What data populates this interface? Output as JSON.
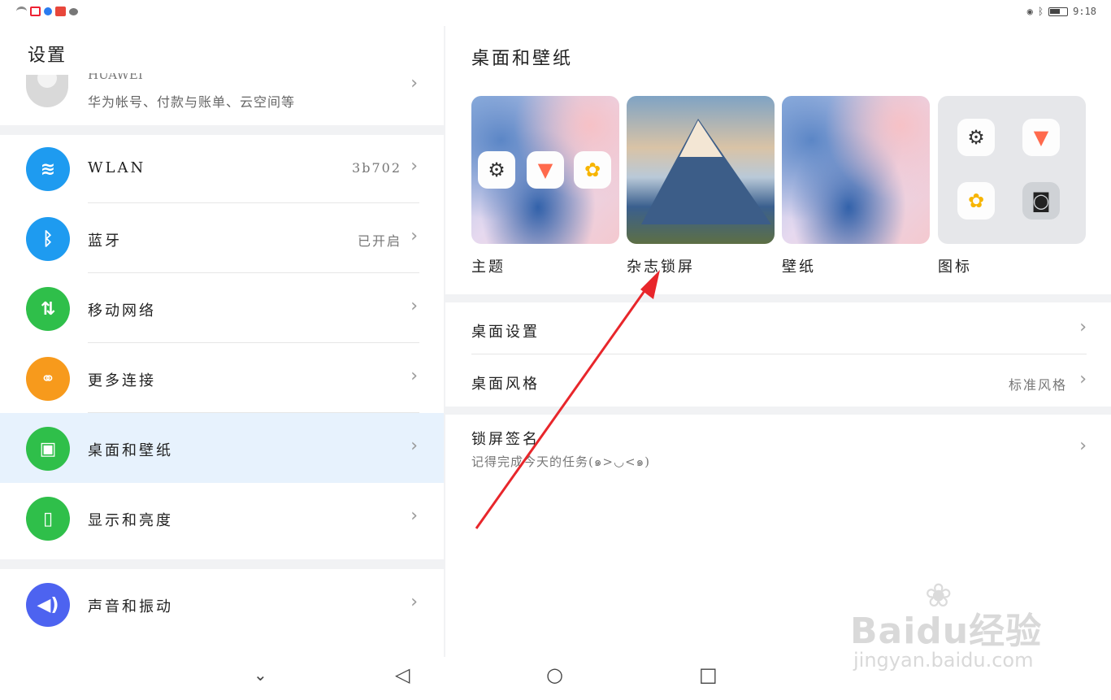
{
  "status_bar": {
    "time": "9:18"
  },
  "left_panel": {
    "title": "设置",
    "account": {
      "name": "HUAWEI",
      "subtitle": "华为帐号、付款与账单、云空间等"
    },
    "items": [
      {
        "label": "WLAN",
        "value": "3b702",
        "color": "#1e9bf0",
        "icon": "wifi-icon",
        "glyph": "≋"
      },
      {
        "label": "蓝牙",
        "value": "已开启",
        "color": "#1e9bf0",
        "icon": "bluetooth-icon",
        "glyph": "ᛒ"
      },
      {
        "label": "移动网络",
        "value": "",
        "color": "#2fbf4a",
        "icon": "mobile-data-icon",
        "glyph": "⇅"
      },
      {
        "label": "更多连接",
        "value": "",
        "color": "#f79a1c",
        "icon": "link-icon",
        "glyph": "⚭"
      },
      {
        "label": "桌面和壁纸",
        "value": "",
        "color": "#2fbf4a",
        "icon": "image-icon",
        "glyph": "▣"
      },
      {
        "label": "显示和亮度",
        "value": "",
        "color": "#2fbf4a",
        "icon": "display-icon",
        "glyph": "▯"
      },
      {
        "label": "声音和振动",
        "value": "",
        "color": "#4d63f0",
        "icon": "sound-icon",
        "glyph": "◀)"
      }
    ]
  },
  "right_panel": {
    "title": "桌面和壁纸",
    "tiles": [
      {
        "label": "主题"
      },
      {
        "label": "杂志锁屏"
      },
      {
        "label": "壁纸"
      },
      {
        "label": "图标"
      }
    ],
    "rows": [
      {
        "label": "桌面设置",
        "value": ""
      },
      {
        "label": "桌面风格",
        "value": "标准风格"
      },
      {
        "label": "锁屏签名",
        "subtitle": "记得完成今天的任务(๑>◡<๑)"
      }
    ]
  },
  "watermark": {
    "brand": "Baidu经验",
    "url": "jingyan.baidu.com"
  },
  "colors": {
    "active_bg": "#e7f2fd",
    "arrow": "#e8262b"
  }
}
